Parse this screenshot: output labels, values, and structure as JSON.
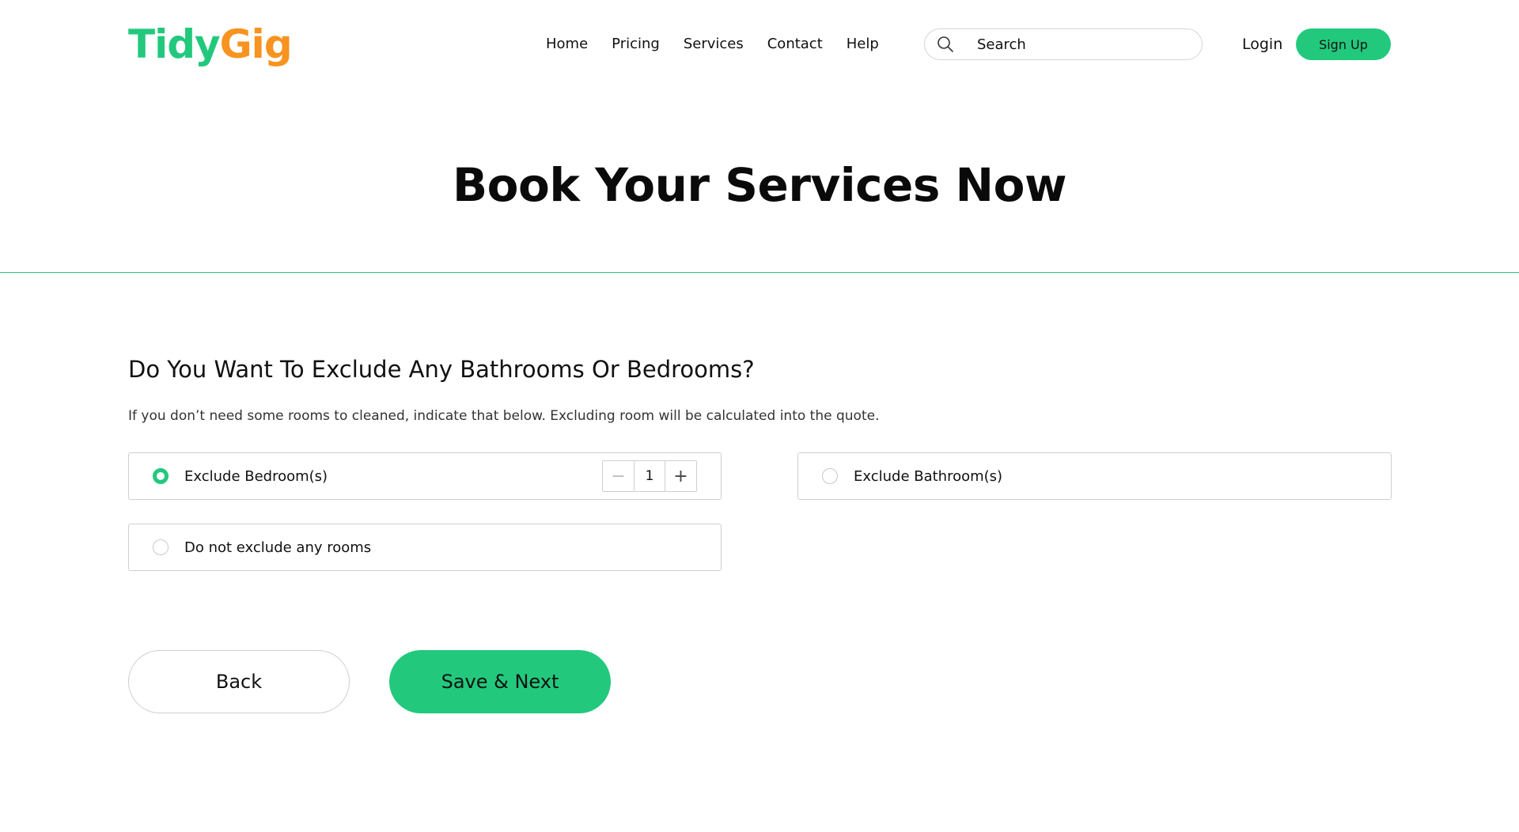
{
  "brand": {
    "logo_part1": "Tidy",
    "logo_part2": "Gig",
    "primary_color": "#22c97d",
    "accent_color": "#f7931e"
  },
  "nav": {
    "items": [
      {
        "label": "Home"
      },
      {
        "label": "Pricing"
      },
      {
        "label": "Services"
      },
      {
        "label": "Contact"
      },
      {
        "label": "Help"
      }
    ]
  },
  "search": {
    "placeholder": "Search",
    "icon": "search-icon"
  },
  "auth": {
    "login_label": "Login",
    "signup_label": "Sign Up"
  },
  "hero": {
    "title": "Book Your Services Now"
  },
  "form": {
    "question": "Do You Want To Exclude Any Bathrooms Or Bedrooms?",
    "hint": "If you don’t need some rooms to cleaned, indicate that below. Excluding room will be calculated into the quote.",
    "options": [
      {
        "label": "Exclude Bedroom(s)",
        "selected": true,
        "count": "1"
      },
      {
        "label": "Exclude Bathroom(s)",
        "selected": false
      },
      {
        "label": "Do not exclude any rooms",
        "selected": false
      }
    ],
    "stepper": {
      "minus": "−",
      "plus": "+"
    }
  },
  "actions": {
    "back_label": "Back",
    "next_label": "Save & Next"
  }
}
